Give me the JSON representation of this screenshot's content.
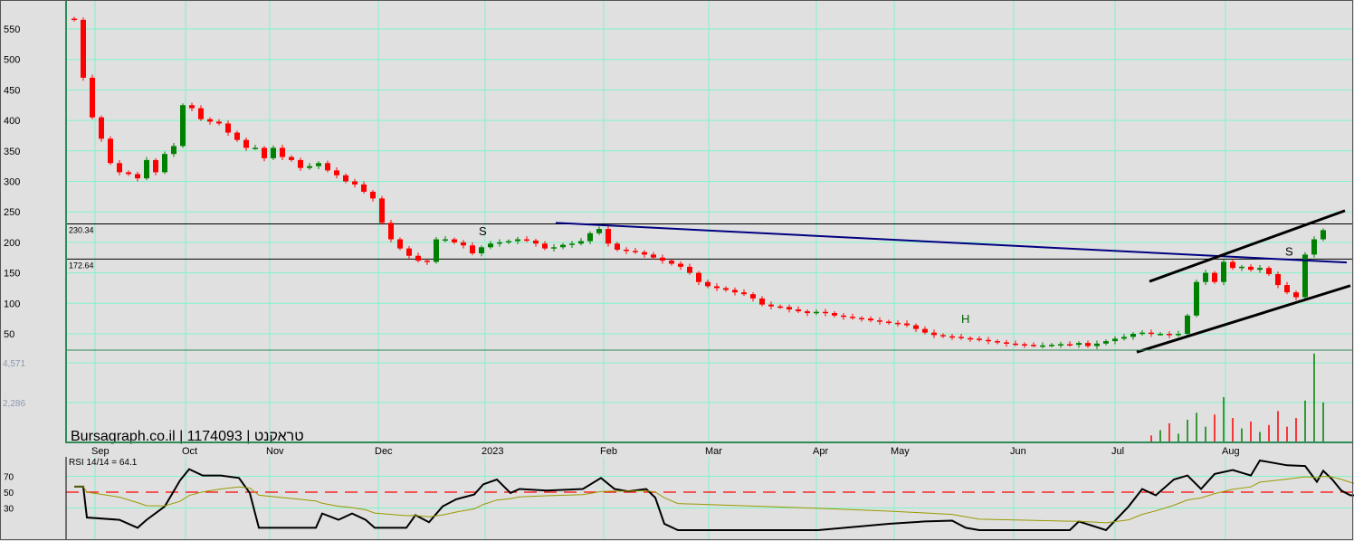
{
  "chart_data": {
    "type": "candlestick",
    "title": "Bursagraph.co.il | 1174093 | טראקנט",
    "y_ticks": [
      550,
      500,
      450,
      400,
      350,
      300,
      250,
      200,
      150,
      100,
      50
    ],
    "ylim": [
      27,
      580
    ],
    "volume_ticks": [
      "4,571",
      "2,286"
    ],
    "volume_tick_values": [
      4571,
      2286
    ],
    "rsi_ticks": [
      70,
      50,
      30
    ],
    "rsi_label": "RSI 14/14 = 64.1",
    "rsi_reference": 50,
    "months": [
      "Sep",
      "Oct",
      "Nov",
      "Dec",
      "2023",
      "Feb",
      "Mar",
      "Apr",
      "May",
      "Jun",
      "Jul",
      "Aug"
    ],
    "levels": [
      {
        "label": "230.34",
        "value": 230.34
      },
      {
        "label": "172.64",
        "value": 172.64
      }
    ],
    "closes": [
      565,
      470,
      405,
      370,
      330,
      315,
      312,
      305,
      335,
      315,
      345,
      358,
      425,
      420,
      402,
      398,
      395,
      380,
      368,
      355,
      355,
      338,
      355,
      340,
      335,
      322,
      325,
      330,
      318,
      310,
      300,
      295,
      283,
      272,
      232,
      205,
      190,
      178,
      170,
      168,
      205,
      205,
      200,
      195,
      182,
      192,
      198,
      200,
      202,
      205,
      203,
      198,
      190,
      192,
      196,
      198,
      202,
      215,
      222,
      198,
      188,
      186,
      184,
      180,
      175,
      170,
      165,
      160,
      150,
      135,
      128,
      125,
      122,
      118,
      115,
      108,
      98,
      95,
      94,
      90,
      87,
      84,
      86,
      84,
      80,
      78,
      76,
      75,
      72,
      70,
      68,
      67,
      64,
      58,
      52,
      48,
      46,
      45,
      43,
      42,
      40,
      38,
      36,
      34,
      33,
      32,
      31,
      31,
      32,
      33,
      32,
      35,
      30,
      34,
      38,
      42,
      45,
      50,
      52,
      50,
      50,
      48,
      50,
      80,
      135,
      150,
      135,
      168,
      158,
      160,
      155,
      158,
      148,
      130,
      118,
      110,
      180,
      205,
      220
    ],
    "volume_tail": [
      400,
      700,
      1100,
      500,
      1300,
      1700,
      900,
      1600,
      2600,
      1400,
      800,
      1200,
      600,
      1000,
      1800,
      900,
      1400,
      2400,
      5100,
      2300
    ],
    "rsi": [
      [
        0,
        57
      ],
      [
        1,
        57
      ],
      [
        1.4,
        18
      ],
      [
        5,
        15
      ],
      [
        7,
        5
      ],
      [
        8,
        15
      ],
      [
        10,
        32
      ],
      [
        11.7,
        65
      ],
      [
        12.7,
        79
      ],
      [
        14.2,
        71
      ],
      [
        16.2,
        71
      ],
      [
        18.2,
        68
      ],
      [
        19.4,
        49
      ],
      [
        20.4,
        5
      ],
      [
        26.7,
        5
      ],
      [
        27.4,
        23
      ],
      [
        29.2,
        15
      ],
      [
        30.7,
        23
      ],
      [
        32.2,
        15
      ],
      [
        33.2,
        5
      ],
      [
        36.7,
        5
      ],
      [
        37.7,
        21
      ],
      [
        39.2,
        12
      ],
      [
        40.7,
        32
      ],
      [
        42.2,
        41
      ],
      [
        44.2,
        47
      ],
      [
        45.2,
        60
      ],
      [
        46.7,
        66
      ],
      [
        48.2,
        49
      ],
      [
        49.2,
        54
      ],
      [
        52.2,
        52
      ],
      [
        56.2,
        54
      ],
      [
        58.2,
        68
      ],
      [
        59.7,
        54
      ],
      [
        61.2,
        51
      ],
      [
        63.2,
        54
      ],
      [
        64.2,
        43
      ],
      [
        65.2,
        10
      ],
      [
        66.7,
        2
      ],
      [
        82.2,
        2
      ],
      [
        90,
        10
      ],
      [
        94,
        13
      ],
      [
        97,
        14
      ],
      [
        98.5,
        5
      ],
      [
        100,
        2
      ],
      [
        110,
        2
      ],
      [
        111,
        13
      ],
      [
        114,
        2
      ],
      [
        116.5,
        32
      ],
      [
        118,
        54
      ],
      [
        119.5,
        46
      ],
      [
        121.5,
        66
      ],
      [
        123,
        71
      ],
      [
        124.5,
        54
      ],
      [
        126,
        73
      ],
      [
        128,
        78
      ],
      [
        130,
        71
      ],
      [
        131,
        90
      ],
      [
        134,
        84
      ],
      [
        136,
        83
      ],
      [
        138,
        77
      ],
      [
        139,
        66
      ],
      [
        140,
        52
      ],
      [
        141,
        46
      ],
      [
        141.8,
        46
      ],
      [
        142.5,
        27
      ],
      [
        143.2,
        32
      ],
      [
        144,
        49
      ],
      [
        137.3,
        63
      ]
    ],
    "trend_lines": [
      {
        "name": "resistance",
        "from": [
          53.2,
          232
        ],
        "to": [
          140.6,
          167
        ],
        "color": "#000080"
      },
      {
        "name": "channel-upper",
        "from": [
          118.8,
          136
        ],
        "to": [
          140.4,
          252
        ],
        "color": "#000000"
      },
      {
        "name": "channel-lower",
        "from": [
          117.4,
          20
        ],
        "to": [
          141,
          129
        ],
        "color": "#000000"
      }
    ],
    "annotations": [
      {
        "text": "S",
        "at": [
          44.7,
          212
        ]
      },
      {
        "text": "H",
        "at": [
          98,
          68
        ]
      },
      {
        "text": "S",
        "at": [
          133.8,
          178
        ]
      }
    ],
    "colors": {
      "up": "#008000",
      "down": "#ff0000",
      "grid": "#80f5c8",
      "background": "#e0e0e0",
      "rsi": "#000000",
      "rsi_signal": "#999900"
    }
  }
}
